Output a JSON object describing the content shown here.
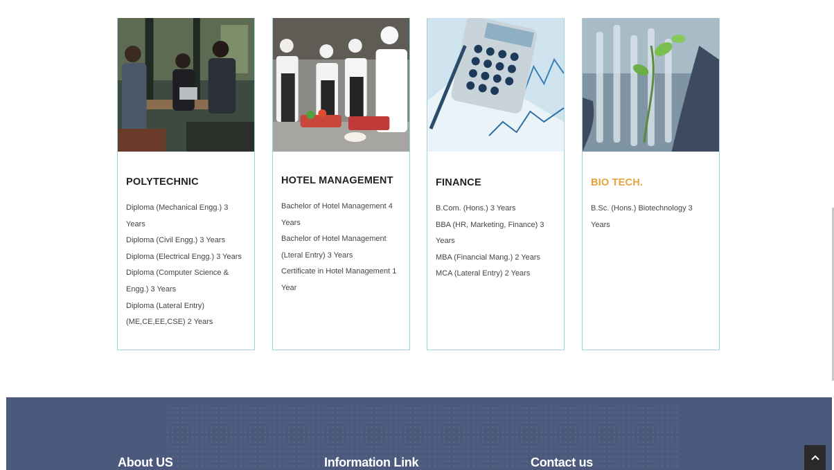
{
  "courses": [
    {
      "title": "POLYTECHNIC",
      "image": "students-table-photo",
      "items": [
        "Diploma (Mechanical Engg.) 3 Years",
        "Diploma (Civil Engg.) 3 Years",
        "Diploma (Electrical Engg.) 3 Years",
        "Diploma (Computer Science & Engg.) 3 Years",
        "Diploma (Lateral Entry) (ME,CE,EE,CSE) 2 Years"
      ]
    },
    {
      "title": "HOTEL MANAGEMENT",
      "image": "chefs-kitchen-photo",
      "items": [
        "Bachelor of Hotel Management 4 Years",
        "Bachelor of Hotel Management (Lteral Entry) 3 Years",
        "Certificate in Hotel Management 1 Year"
      ]
    },
    {
      "title": "FINANCE",
      "image": "calculator-charts-photo",
      "items": [
        "B.Com. (Hons.) 3 Years",
        "BBA (HR, Marketing, Finance) 3 Years",
        "MBA (Financial Mang.) 2 Years",
        "MCA (Lateral Entry) 2 Years"
      ]
    },
    {
      "title": "BIO TECH.",
      "image": "lab-test-tubes-photo",
      "items": [
        "B.Sc. (Hons.) Biotechnology 3 Years"
      ]
    }
  ],
  "footer": {
    "about": "About US",
    "info": "Information Link",
    "contact": "Contact us"
  },
  "colors": {
    "accent": "#e8a23a",
    "footer_bg": "#4b5a7c",
    "card_border": "#9fd3dc"
  },
  "icons": {
    "scroll_top": "chevron-up-icon"
  }
}
